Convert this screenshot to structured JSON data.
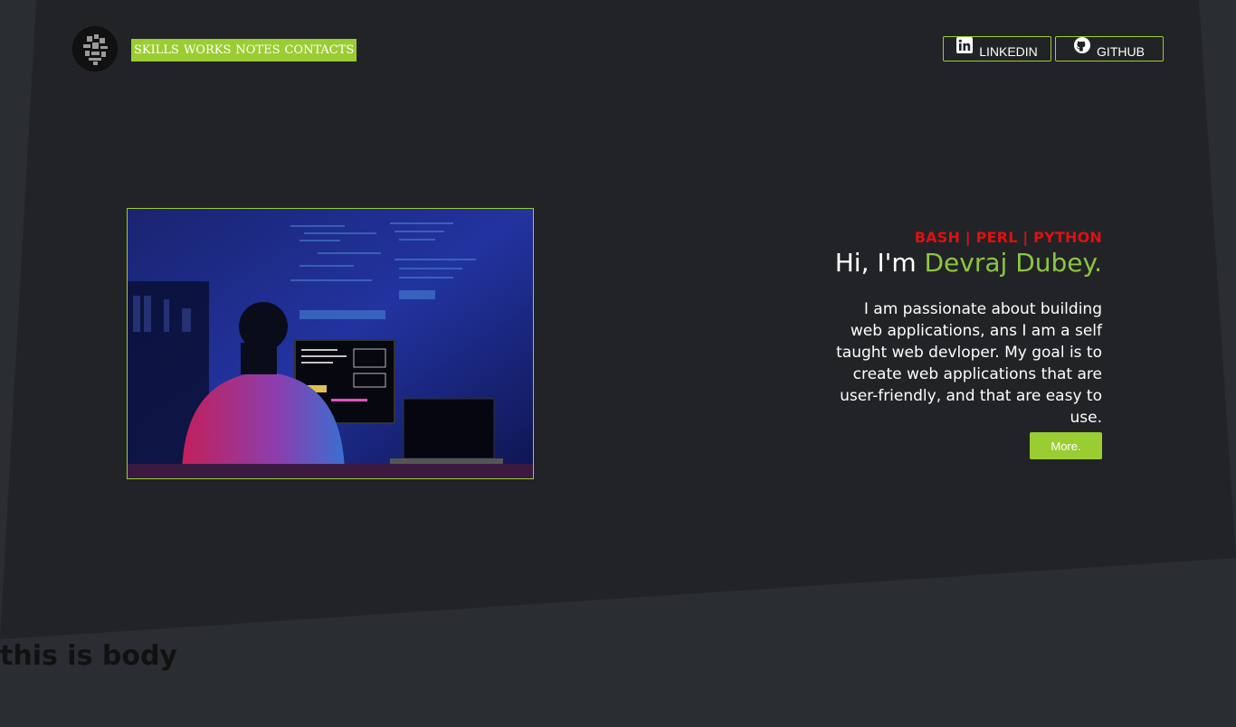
{
  "nav": {
    "items": [
      "SKILLS",
      "WORKS",
      "NOTES",
      "CONTACTS"
    ]
  },
  "social": {
    "linkedin_label": "LINKEDIN",
    "github_label": "GITHUB"
  },
  "hero": {
    "tagline": "BASH | PERL | PYTHON",
    "greeting_prefix": "Hi, I'm ",
    "name": "Devraj Dubey.",
    "bio": "I am passionate about building web applications, ans I am a self taught web devloper. My goal is to create web applications that are user-friendly, and that are easy to use.",
    "more_label": "More."
  },
  "body_text": "this is body",
  "colors": {
    "accent": "#9acd32",
    "name": "#8dc63f",
    "tagline": "#e01010",
    "hero_bg": "#222327",
    "page_bg": "#2a2d31"
  },
  "icons": {
    "logo": "logo-icon",
    "linkedin": "linkedin-icon",
    "github": "github-icon"
  }
}
